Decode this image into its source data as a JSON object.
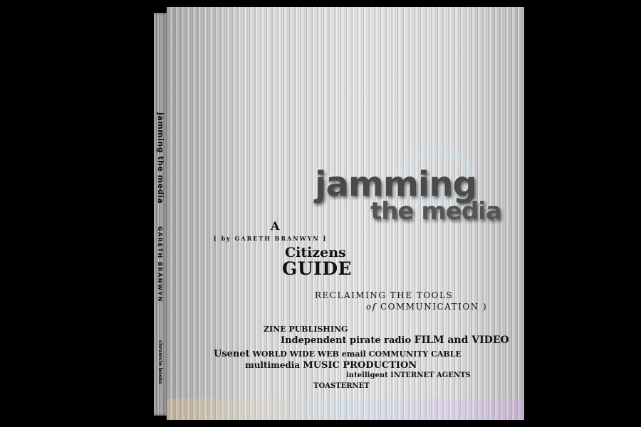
{
  "book": {
    "logo_line1": "jamming",
    "logo_line2": "the media",
    "article": "A",
    "author": "[ by GARETH BRANWYN ]",
    "citizens": "Citizens",
    "guide": "GUIDE",
    "reclaim_line1": "RECLAIMING THE TOOLS",
    "reclaim_of": "of",
    "reclaim_line2": "COMMUNICATION )",
    "topics": {
      "l1": "ZINE PUBLISHING",
      "l2a": "Independent pirate radio",
      "l2b": "FILM and VIDEO",
      "l3a": "Usenet",
      "l3b": "WORLD WIDE WEB email COMMUNITY CABLE",
      "l4a": "multimedia",
      "l4b": "MUSIC PRODUCTION",
      "l5": "intelligent INTERNET AGENTS",
      "l6": "TOASTERNET"
    },
    "spine": {
      "title": "jamming the media",
      "author": "GARETH BRANWYN",
      "publisher": "chronicle books"
    }
  }
}
